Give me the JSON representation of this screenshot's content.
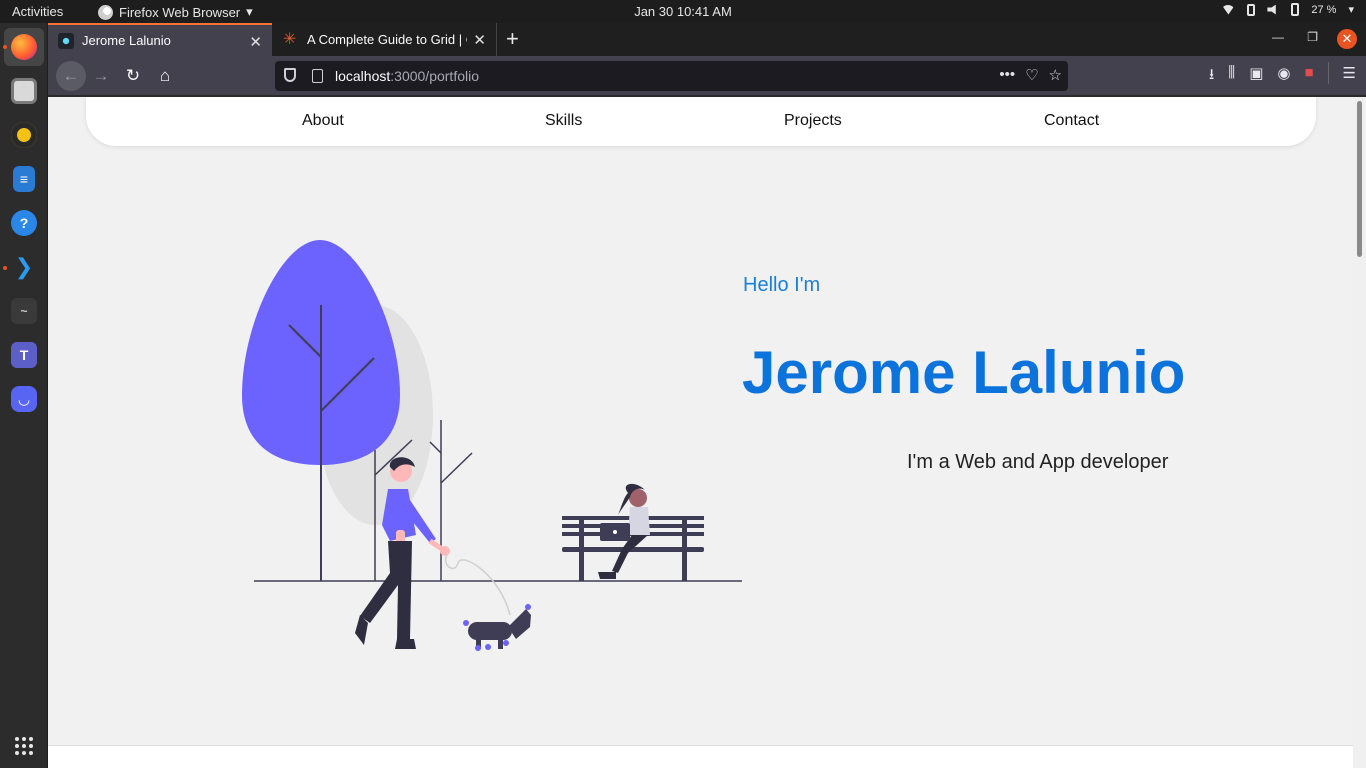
{
  "system": {
    "activities": "Activities",
    "app_menu": "Firefox Web Browser",
    "clock": "Jan 30  10:41 AM",
    "battery": "27 %"
  },
  "browser": {
    "tabs": [
      {
        "title": "Jerome Lalunio"
      },
      {
        "title": "A Complete Guide to Grid | CSS-Tricks"
      }
    ],
    "url_host": "localhost",
    "url_rest": ":3000/portfolio"
  },
  "site": {
    "nav": [
      "About",
      "Skills",
      "Projects",
      "Contact"
    ],
    "hero": {
      "greeting": "Hello I'm",
      "name": "Jerome Lalunio",
      "tagline": "I'm a Web and App developer"
    }
  },
  "colors": {
    "accent": "#0d73dc",
    "illustration": "#6c63ff",
    "firefox_orange": "#ff7139"
  },
  "icons": {
    "dock": [
      "firefox-icon",
      "files-icon",
      "rhythmbox-icon",
      "writer-icon",
      "help-icon",
      "vscode-icon",
      "system-monitor-icon",
      "teams-icon",
      "discord-icon",
      "show-apps-icon"
    ]
  }
}
